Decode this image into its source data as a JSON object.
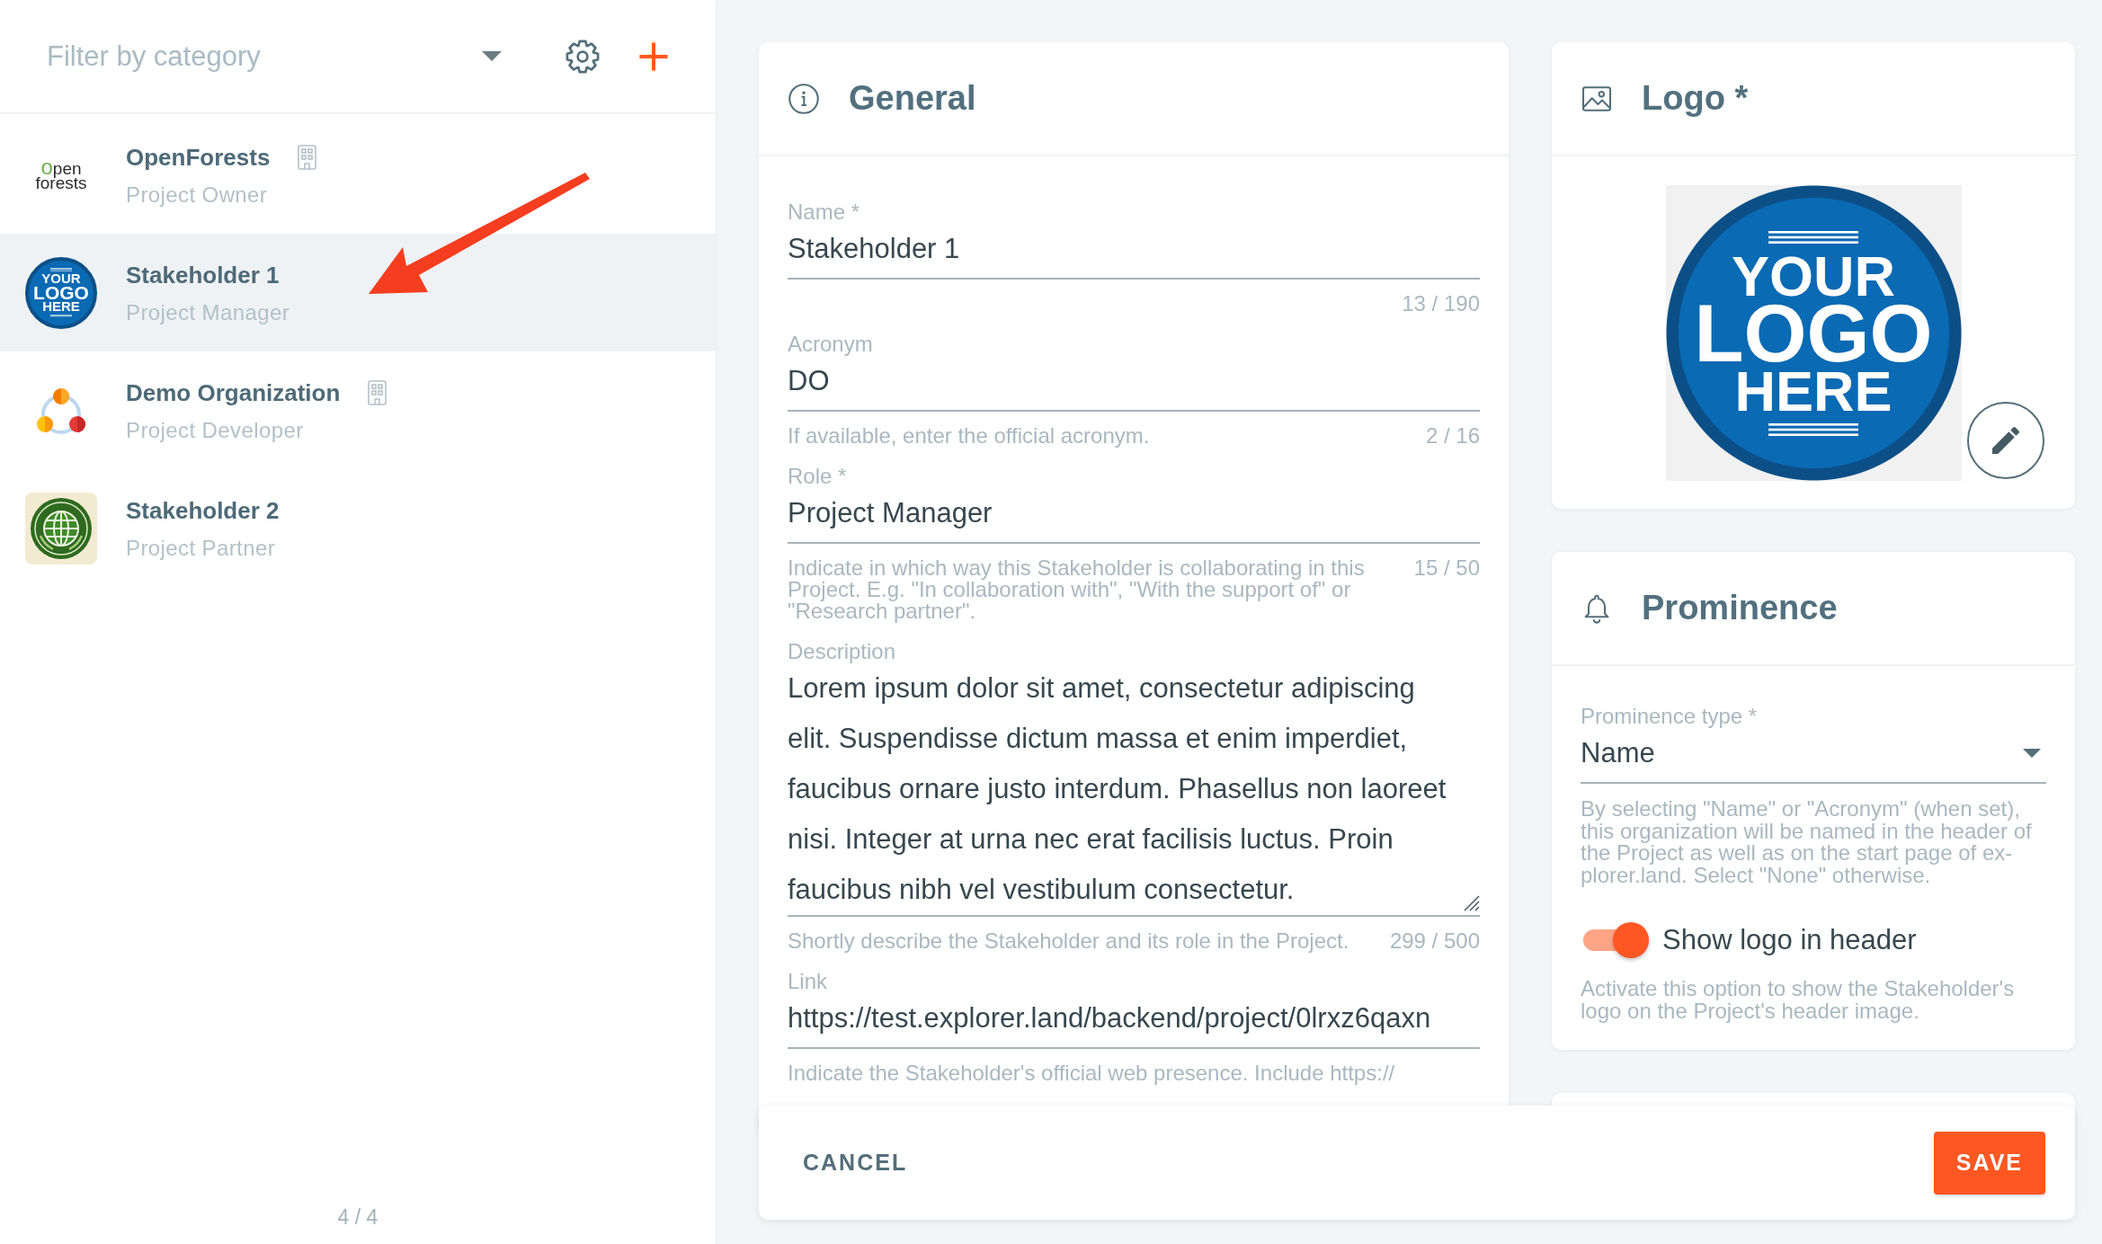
{
  "sidebar": {
    "filter": {
      "placeholder": "Filter by category"
    },
    "items": [
      {
        "name": "OpenForests",
        "role": "Project Owner",
        "organization": true,
        "selected": false,
        "avatar": {
          "kind": "wordmark",
          "text": "open forests"
        }
      },
      {
        "name": "Stakeholder 1",
        "role": "Project Manager",
        "organization": false,
        "selected": true,
        "avatar": {
          "kind": "badge",
          "lines": [
            "YOUR",
            "LOGO",
            "HERE"
          ]
        }
      },
      {
        "name": "Demo Organization",
        "role": "Project Developer",
        "organization": true,
        "selected": false,
        "avatar": {
          "kind": "dots"
        }
      },
      {
        "name": "Stakeholder 2",
        "role": "Project Partner",
        "organization": false,
        "selected": false,
        "avatar": {
          "kind": "emblem"
        }
      }
    ],
    "count": "4 / 4"
  },
  "general": {
    "title": "General",
    "fields": [
      {
        "kind": "input",
        "label": "Name *",
        "value": "Stakeholder 1",
        "counter": "13 / 190"
      },
      {
        "kind": "input",
        "label": "Acronym",
        "value": "DO",
        "hint": "If available, enter the official acronym.",
        "counter": "2 / 16"
      },
      {
        "kind": "input",
        "label": "Role *",
        "value": "Project Manager",
        "hint": "Indicate in which way this Stakeholder is collaborating in this Project. E.g. \"In collaboration with\", \"With the support of\" or \"Research partner\".",
        "counter": "15 / 50"
      },
      {
        "kind": "textarea",
        "label": "Description",
        "value": "Lorem ipsum dolor sit amet, consectetur adipiscing elit. Suspendisse dictum massa et enim imperdiet, faucibus ornare justo interdum. Phasellus non laoreet nisi. Integer at urna nec erat facilisis luctus. Proin faucibus nibh vel vestibulum consectetur.",
        "hint": "Shortly describe the Stakeholder and its role in the Project.",
        "counter": "299 / 500"
      },
      {
        "kind": "input",
        "label": "Link",
        "value": "https://test.explorer.land/backend/project/0lrxz6qaxn",
        "hint": "Indicate the Stakeholder's official web presence. Include https://"
      }
    ]
  },
  "logo": {
    "title": "Logo *",
    "image": {
      "kind": "badge",
      "lines": [
        "YOUR",
        "LOGO",
        "HERE"
      ]
    }
  },
  "prominence": {
    "title": "Prominence",
    "select": {
      "label": "Prominence type *",
      "value": "Name",
      "hint": "By selecting \"Name\" or \"Acronym\" (when set), this organization will be named in the header of the Project as well as on the start page of ex-plorer.land. Select \"None\" otherwise."
    },
    "toggle": {
      "label": "Show logo in header",
      "on": true,
      "hint": "Activate this option to show the Stakeholder's logo on the Project's header image."
    }
  },
  "footer": {
    "buttons": [
      {
        "kind": "text",
        "label": "CANCEL"
      },
      {
        "kind": "primary",
        "label": "SAVE"
      }
    ]
  }
}
